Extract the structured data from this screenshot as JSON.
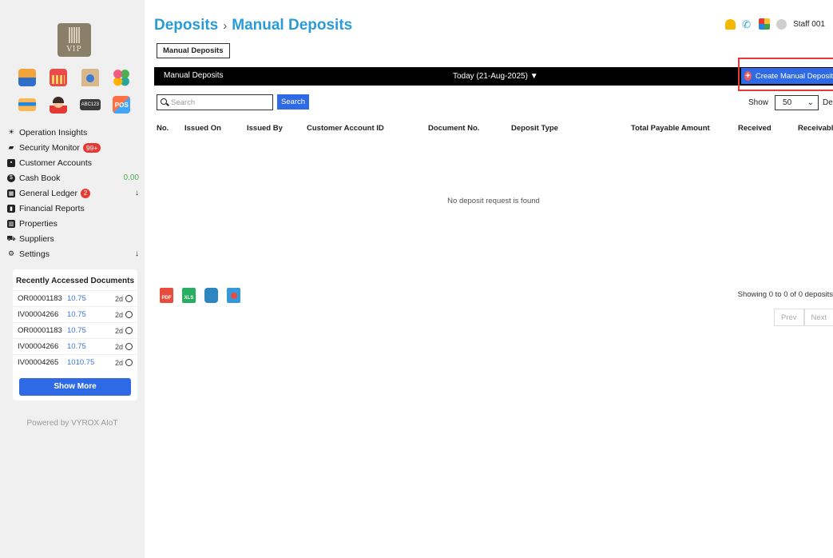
{
  "brand": {
    "logo_text": "VIP",
    "powered_by": "Powered by VYROX AIoT"
  },
  "quick_icons": [
    {
      "name": "badge-icon"
    },
    {
      "name": "calendar-icon"
    },
    {
      "name": "bank-icon"
    },
    {
      "name": "apps-icon"
    },
    {
      "name": "card-icon"
    },
    {
      "name": "face-icon"
    },
    {
      "name": "abc123-icon",
      "label": "ABC123"
    },
    {
      "name": "pos-icon",
      "label": "POS"
    }
  ],
  "menu": [
    {
      "id": "operation-insights",
      "label": "Operation Insights"
    },
    {
      "id": "security-monitor",
      "label": "Security Monitor",
      "badge": "99+"
    },
    {
      "id": "customer-accounts",
      "label": "Customer Accounts"
    },
    {
      "id": "cash-book",
      "label": "Cash Book",
      "value": "0.00"
    },
    {
      "id": "general-ledger",
      "label": "General Ledger",
      "badge": "2",
      "arrow": "↓"
    },
    {
      "id": "financial-reports",
      "label": "Financial Reports"
    },
    {
      "id": "properties",
      "label": "Properties"
    },
    {
      "id": "suppliers",
      "label": "Suppliers"
    },
    {
      "id": "settings",
      "label": "Settings",
      "arrow": "↓"
    }
  ],
  "recent": {
    "title": "Recently Accessed Documents",
    "rows": [
      {
        "doc": "OR00001183",
        "amount": "10.75",
        "age": "2d"
      },
      {
        "doc": "IV00004266",
        "amount": "10.75",
        "age": "2d"
      },
      {
        "doc": "OR00001183",
        "amount": "10.75",
        "age": "2d"
      },
      {
        "doc": "IV00004266",
        "amount": "10.75",
        "age": "2d"
      },
      {
        "doc": "IV00004265",
        "amount": "1010.75",
        "age": "2d"
      }
    ],
    "show_more": "Show More"
  },
  "header": {
    "title": "Deposits",
    "separator": "›",
    "subtitle": "Manual Deposits",
    "user": "Staff 001"
  },
  "tab": {
    "label": "Manual Deposits"
  },
  "toolbar": {
    "left": "Manual Deposits",
    "date_filter": "Today (21-Aug-2025) ▼",
    "create_label": "Create Manual Deposit"
  },
  "search": {
    "placeholder": "Search",
    "button": "Search"
  },
  "page_size": {
    "show_label": "Show",
    "value": "50",
    "suffix": "Deposits"
  },
  "table": {
    "columns": [
      "No.",
      "Issued On",
      "Issued By",
      "Customer Account ID",
      "Document No.",
      "Deposit Type",
      "Total Payable Amount",
      "Received",
      "Receivable"
    ],
    "empty_message": "No deposit request is found"
  },
  "export": [
    {
      "name": "pdf-export-icon",
      "label": "PDF"
    },
    {
      "name": "xls-export-icon",
      "label": "XLS"
    },
    {
      "name": "print-icon"
    },
    {
      "name": "other-export-icon"
    }
  ],
  "pagination": {
    "summary": "Showing 0 to 0 of 0 deposits",
    "prev": "Prev",
    "next": "Next"
  },
  "colors": {
    "accent": "#2f6ae6",
    "title": "#2a9bd6",
    "badge": "#e53935",
    "highlight_border": "#e53935"
  }
}
